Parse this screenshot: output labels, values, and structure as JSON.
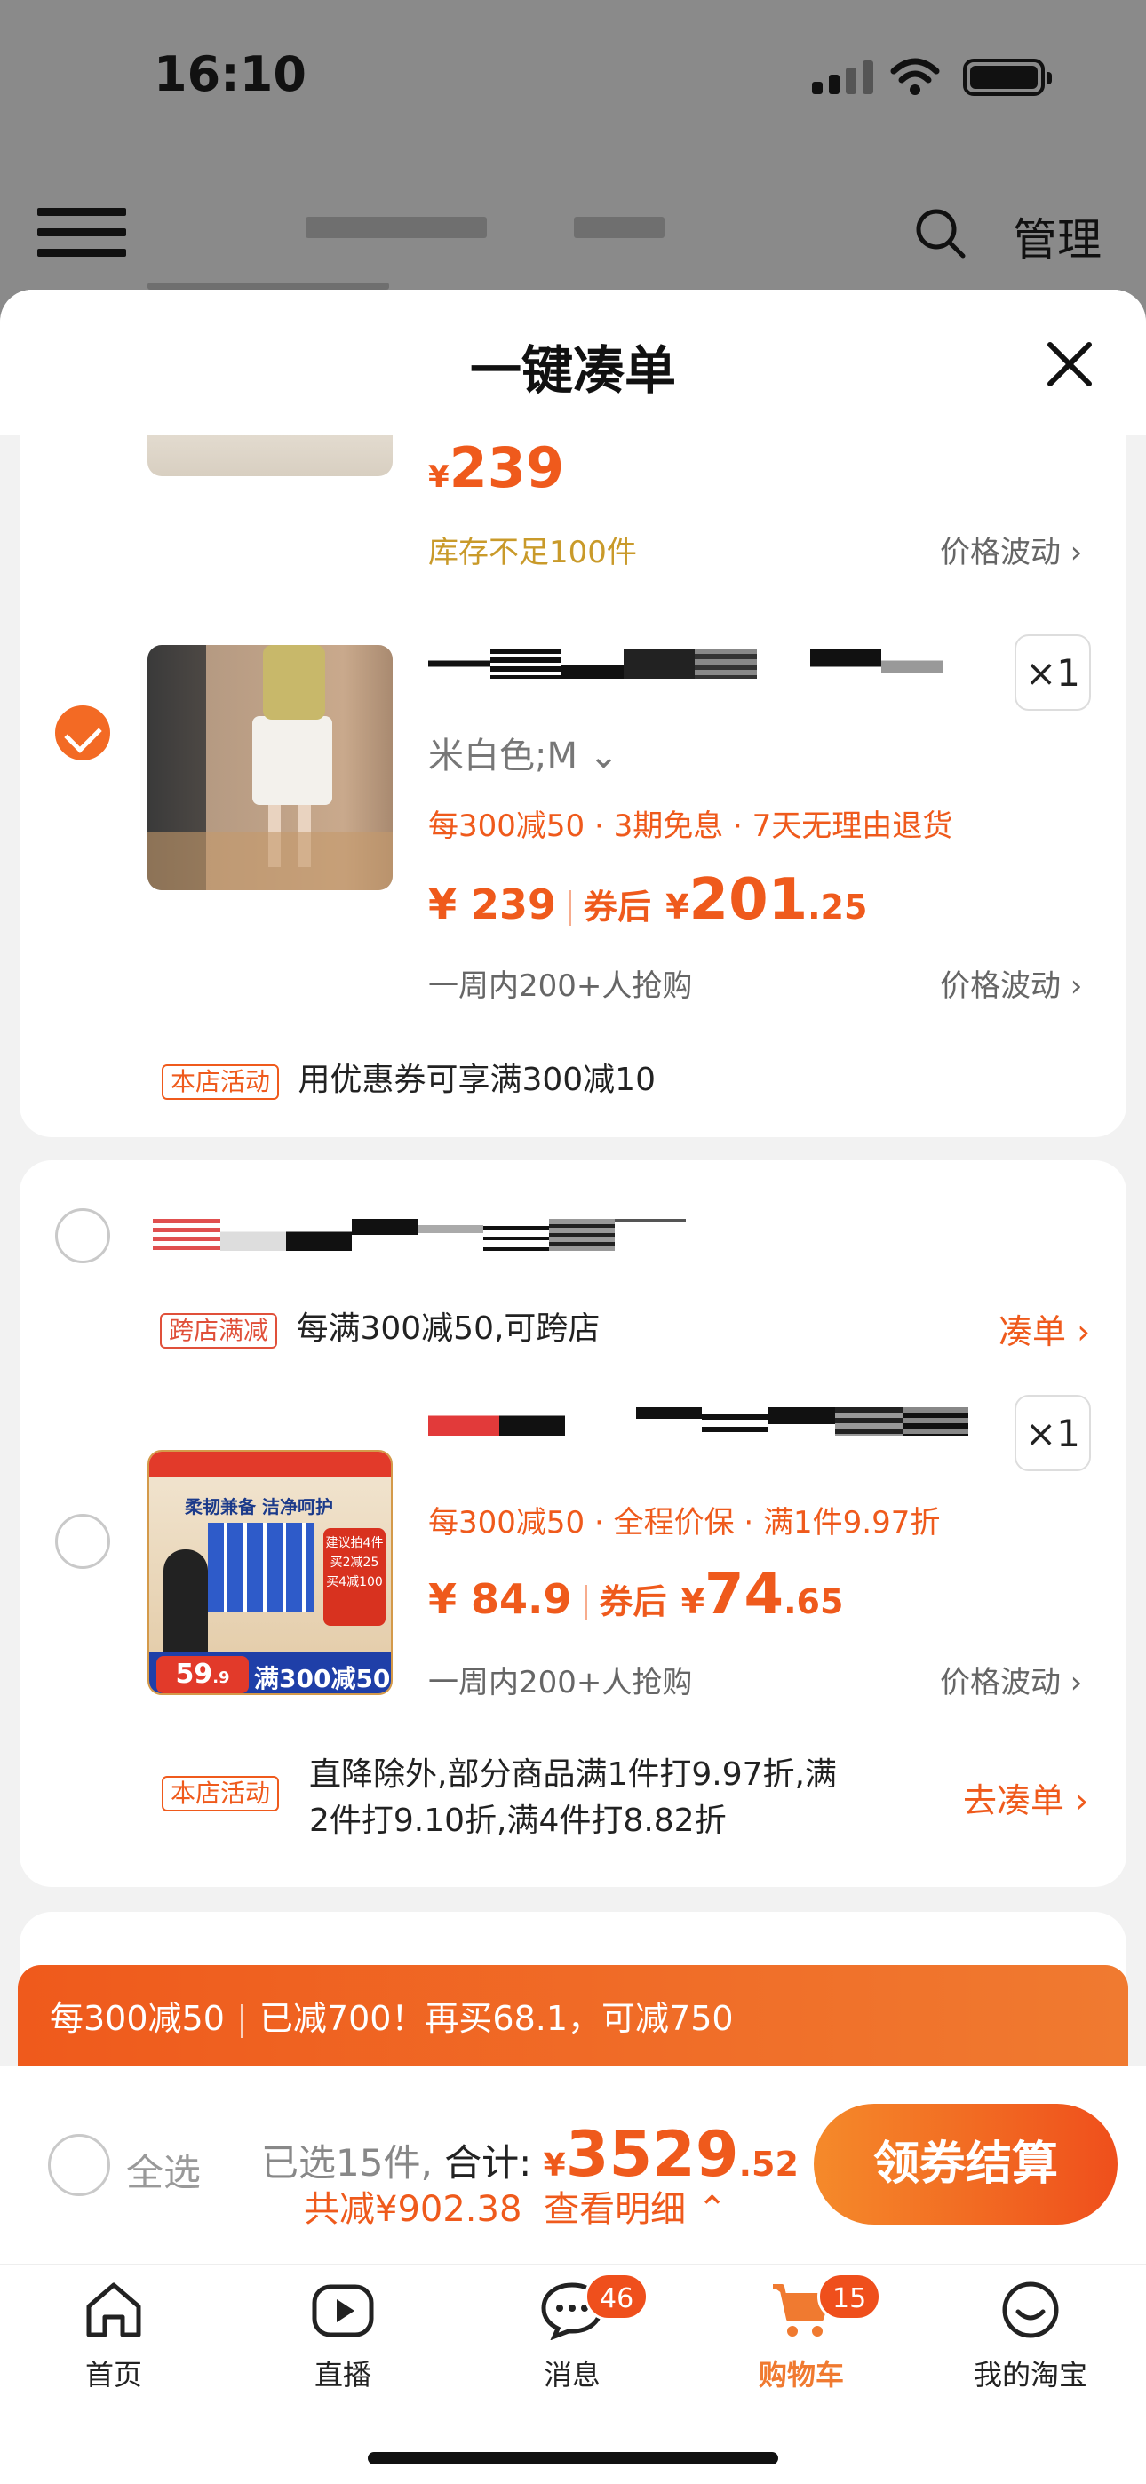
{
  "status_bar": {
    "time": "16:10"
  },
  "background_page": {
    "manage_label": "管理"
  },
  "sheet": {
    "title": "一键凑单"
  },
  "item0": {
    "price_symbol": "¥",
    "price": "239",
    "stock_note": "库存不足100件",
    "price_fluct": "价格波动 ›"
  },
  "item1": {
    "sku": "米白色;M ⌄",
    "benefits": "每300减50 · 3期免息 · 7天无理由退货",
    "price": "¥ 239",
    "after_label": "券后",
    "after_symbol": "¥",
    "after_int": "201",
    "after_dec": ".25",
    "popularity": "一周内200+人抢购",
    "price_fluct": "价格波动 ›",
    "qty": "×1",
    "store_tag": "本店活动",
    "store_text": "用优惠券可享满300减10"
  },
  "store2": {
    "cross_tag": "跨店满减",
    "cross_text": "每满300减50,可跨店",
    "cou_link": "凑单 ›",
    "thumb_top": "柔韧兼备 洁净呵护",
    "thumb_price_int": "59",
    "thumb_price_dec": ".9",
    "thumb_promo": "满300减50",
    "thumb_badge1": "建议拍4件",
    "thumb_badge2": "买2减25",
    "thumb_badge3": "买4减100"
  },
  "item2": {
    "benefits": "每300减50 · 全程价保 · 满1件9.97折",
    "price": "¥ 84.9",
    "after_label": "券后",
    "after_symbol": "¥",
    "after_int": "74",
    "after_dec": ".65",
    "popularity": "一周内200+人抢购",
    "price_fluct": "价格波动 ›",
    "qty": "×1",
    "store_tag": "本店活动",
    "store_text_line1": "直降除外,部分商品满1件打9.97折,满",
    "store_text_line2": "2件打9.10折,满4件打8.82折",
    "go_link": "去凑单 ›"
  },
  "promo_banner": {
    "part1": "每300减50",
    "part2": "已减700！再买68.1，可减750"
  },
  "checkout": {
    "select_all": "全选",
    "selected": "已选15件,",
    "total_label": "合计:",
    "symbol": "¥",
    "total_int": "3529",
    "total_dec": ".52",
    "saved": "共减¥902.38",
    "detail": "查看明细 ⌃",
    "pay_button": "领券结算"
  },
  "tabbar": {
    "home": "首页",
    "live": "直播",
    "messages": "消息",
    "messages_badge": "46",
    "cart": "购物车",
    "cart_badge": "15",
    "mine": "我的淘宝"
  },
  "colors": {
    "accent": "#ef5a1c",
    "gold": "#c99a2a"
  }
}
